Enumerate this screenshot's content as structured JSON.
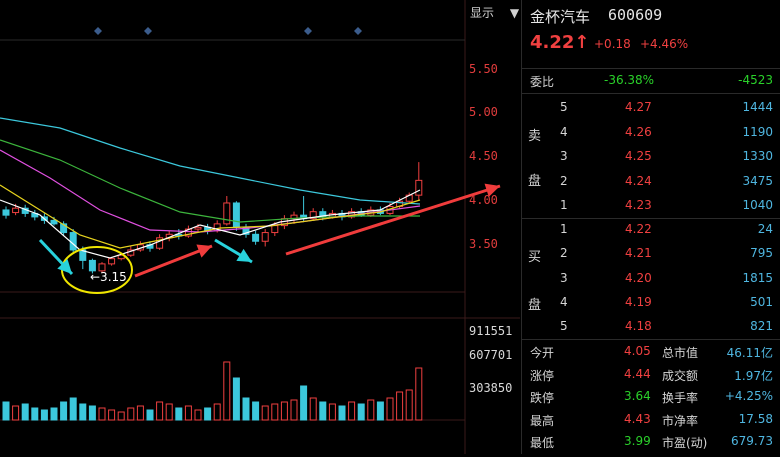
{
  "header": {
    "show_label": "显示",
    "dropdown_icon": "triangle-down-icon"
  },
  "axis": {
    "price_ticks": [
      "5.50",
      "5.00",
      "4.50",
      "4.00",
      "3.50"
    ],
    "volume_ticks": [
      "911551",
      "607701",
      "303850"
    ]
  },
  "annotation": {
    "low_label": "3.15"
  },
  "stock": {
    "name": "金杯汽车",
    "code": "600609",
    "price": "4.22↑",
    "change": "+0.18",
    "change_pct": "+4.46%"
  },
  "ratio": {
    "label": "委比",
    "pct": "-36.38%",
    "value": "-4523"
  },
  "sell_label_1": "卖",
  "sell_label_2": "盘",
  "buy_label_1": "买",
  "buy_label_2": "盘",
  "sell_orders": [
    {
      "level": "5",
      "price": "4.27",
      "volume": "1444"
    },
    {
      "level": "4",
      "price": "4.26",
      "volume": "1190"
    },
    {
      "level": "3",
      "price": "4.25",
      "volume": "1330"
    },
    {
      "level": "2",
      "price": "4.24",
      "volume": "3475"
    },
    {
      "level": "1",
      "price": "4.23",
      "volume": "1040"
    }
  ],
  "buy_orders": [
    {
      "level": "1",
      "price": "4.22",
      "volume": "24"
    },
    {
      "level": "2",
      "price": "4.21",
      "volume": "795"
    },
    {
      "level": "3",
      "price": "4.20",
      "volume": "1815"
    },
    {
      "level": "4",
      "price": "4.19",
      "volume": "501"
    },
    {
      "level": "5",
      "price": "4.18",
      "volume": "821"
    }
  ],
  "stats": [
    {
      "l1": "今开",
      "v1": "4.05",
      "l2": "总市值",
      "v2": "46.11亿"
    },
    {
      "l1": "涨停",
      "v1": "4.44",
      "l2": "成交额",
      "v2": "1.97亿"
    },
    {
      "l1": "跌停",
      "v1": "3.64",
      "l2": "换手率",
      "v2": "+4.25%"
    },
    {
      "l1": "最高",
      "v1": "4.43",
      "l2": "市净率",
      "v2": "17.58"
    },
    {
      "l1": "最低",
      "v1": "3.99",
      "l2": "市盈(动)",
      "v2": "679.73"
    }
  ],
  "colors": {
    "up": "#f04040",
    "down": "#3cc8dc",
    "ma5": "#ffffff",
    "ma10": "#e6d21e",
    "ma20": "#e050e0",
    "ma30": "#3cb43c",
    "ma60": "#3cc8dc",
    "annotation_circle": "#f0e600",
    "arrow_red": "#f03c3c",
    "arrow_cyan": "#28d2dc"
  }
}
